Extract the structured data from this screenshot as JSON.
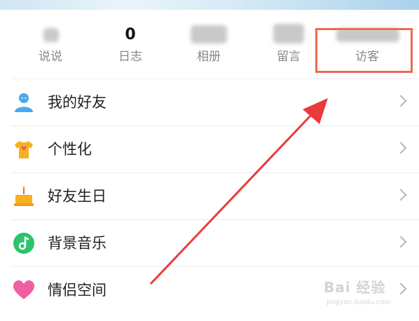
{
  "stats": [
    {
      "value": "",
      "label": "说说"
    },
    {
      "value": "0",
      "label": "日志"
    },
    {
      "value": "",
      "label": "相册"
    },
    {
      "value": "",
      "label": "留言"
    },
    {
      "value": "",
      "label": "访客"
    }
  ],
  "menu": [
    {
      "label": "我的好友",
      "icon": "friends-icon",
      "color": "#4aa8f0"
    },
    {
      "label": "个性化",
      "icon": "tshirt-icon",
      "color": "#f5b21f"
    },
    {
      "label": "好友生日",
      "icon": "cake-icon",
      "color": "#f39a1e"
    },
    {
      "label": "背景音乐",
      "icon": "music-icon",
      "color": "#2dc26b"
    },
    {
      "label": "情侣空间",
      "icon": "heart-icon",
      "color": "#f25fa0"
    }
  ],
  "annotation": {
    "box_color": "#ec6b52",
    "arrow_color": "#e93b3b"
  },
  "watermark": {
    "main": "Bai 经验",
    "url": "jingyan.baidu.com"
  }
}
